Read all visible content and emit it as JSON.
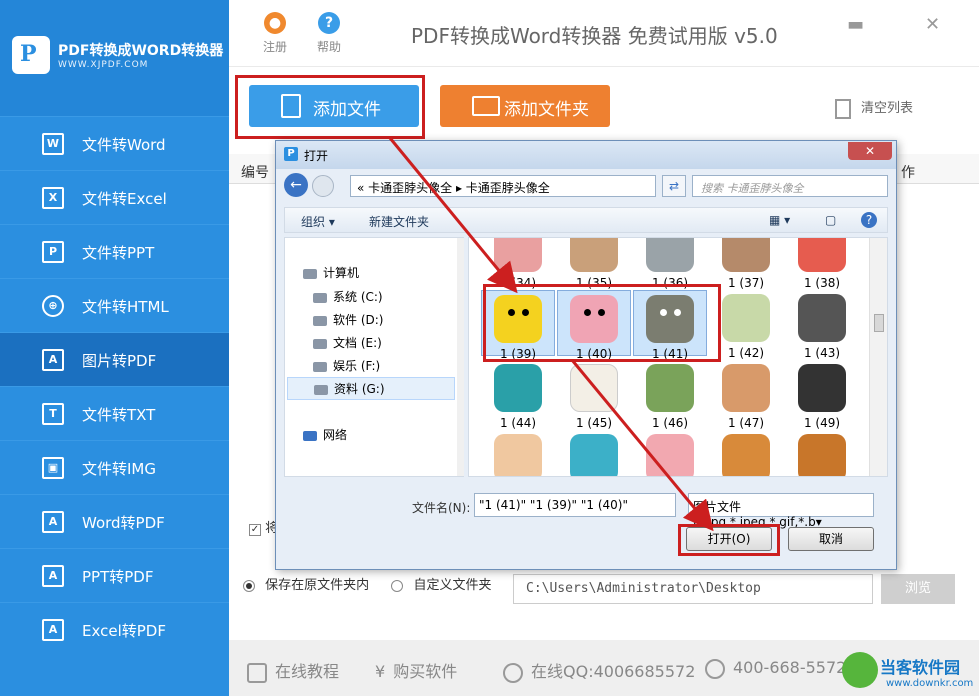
{
  "logo": {
    "title": "PDF转换成WORD转换器",
    "url": "WWW.XJPDF.COM"
  },
  "sidebar": {
    "items": [
      {
        "label": "文件转Word",
        "icon": "W"
      },
      {
        "label": "文件转Excel",
        "icon": "X"
      },
      {
        "label": "文件转PPT",
        "icon": "P"
      },
      {
        "label": "文件转HTML",
        "icon": "⊕"
      },
      {
        "label": "图片转PDF",
        "icon": "A"
      },
      {
        "label": "文件转TXT",
        "icon": "T"
      },
      {
        "label": "文件转IMG",
        "icon": "▣"
      },
      {
        "label": "Word转PDF",
        "icon": "A"
      },
      {
        "label": "PPT转PDF",
        "icon": "A"
      },
      {
        "label": "Excel转PDF",
        "icon": "A"
      }
    ]
  },
  "top": {
    "register": "注册",
    "help": "帮助",
    "title": "PDF转换成Word转换器 免费试用版 v5.0"
  },
  "toolbar": {
    "add_file": "添加文件",
    "add_folder": "添加文件夹",
    "clear_list": "清空列表"
  },
  "table": {
    "col_no": "编号",
    "col_op": "作"
  },
  "options": {
    "check_label": "将",
    "save_original": "保存在原文件夹内",
    "custom_folder": "自定义文件夹",
    "path": "C:\\Users\\Administrator\\Desktop",
    "browse": "浏览"
  },
  "footer": {
    "tutorial": "在线教程",
    "buy": "购买软件",
    "qq": "在线QQ:4006685572",
    "phone": "400-668-5572"
  },
  "watermark": {
    "name": "当客软件园",
    "url": "www.downkr.com"
  },
  "dialog": {
    "title": "打开",
    "breadcrumb": "«  卡通歪脖头像全  ▸  卡通歪脖头像全",
    "search_placeholder": "搜索 卡通歪脖头像全",
    "organize": "组织 ▾",
    "new_folder": "新建文件夹",
    "tree": [
      "计算机",
      "系统 (C:)",
      "软件 (D:)",
      "文档 (E:)",
      "娱乐 (F:)",
      "资料 (G:)",
      "网络"
    ],
    "files": [
      "1 (34)",
      "1 (35)",
      "1 (36)",
      "1 (37)",
      "1 (38)",
      "1 (39)",
      "1 (40)",
      "1 (41)",
      "1 (42)",
      "1 (43)",
      "1 (44)",
      "1 (45)",
      "1 (46)",
      "1 (47)",
      "1 (49)"
    ],
    "filename_label": "文件名(N):",
    "filename": "\"1 (41)\" \"1 (39)\" \"1 (40)\"",
    "filter": "图片文件(*.jpg,*.jpeg,*.gif,*.b▾",
    "open": "打开(O)",
    "cancel": "取消"
  },
  "colors": {
    "sidebar": "#2b8fe0",
    "active": "#1b70c0",
    "add_file": "#3a9de8",
    "add_folder": "#ee8030",
    "highlight": "#cc1f1f"
  }
}
